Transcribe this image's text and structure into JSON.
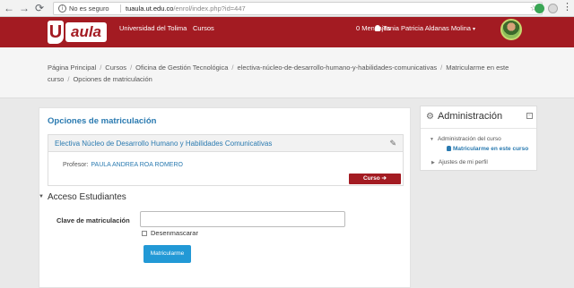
{
  "browser": {
    "insecure_label": "No es seguro",
    "url_host": "tuaula.ut.edu.co",
    "url_path": "/enrol/index.php?id=447",
    "back_icon": "back-arrow-icon",
    "forward_icon": "forward-arrow-icon",
    "reload_icon": "reload-icon"
  },
  "topbar": {
    "logo_u": "U",
    "logo_aula": "aula",
    "nav": [
      "Universidad del Tolima",
      "Cursos"
    ],
    "messages": "0 Mensajes",
    "user_name": "Tania Patricia Aldanas Molina",
    "brand_color": "#a31b22"
  },
  "breadcrumb": {
    "items": [
      "Página Principal",
      "Cursos",
      "Oficina de Gestión Tecnológica",
      "electiva-núcleo-de-desarrollo-humano-y-habilidades-comunicativas",
      "Matricularme en este curso",
      "Opciones de matriculación"
    ]
  },
  "main": {
    "title": "Opciones de matriculación",
    "course_name": "Electiva Núcleo de Desarrollo Humano y Habilidades Comunicativas",
    "professor_label": "Profesor:",
    "professor_name": "PAULA ANDREA ROA ROMERO",
    "course_button": "Curso ➔",
    "section_title": "Acceso Estudiantes",
    "field_label": "Clave de matriculación",
    "field_value": "",
    "checkbox_label": "Desenmascarar",
    "submit_label": "Matricularme"
  },
  "admin": {
    "title": "Administración",
    "items": [
      "Administración del curso",
      "Matricularme en este curso",
      "Ajustes de mi perfil"
    ]
  }
}
